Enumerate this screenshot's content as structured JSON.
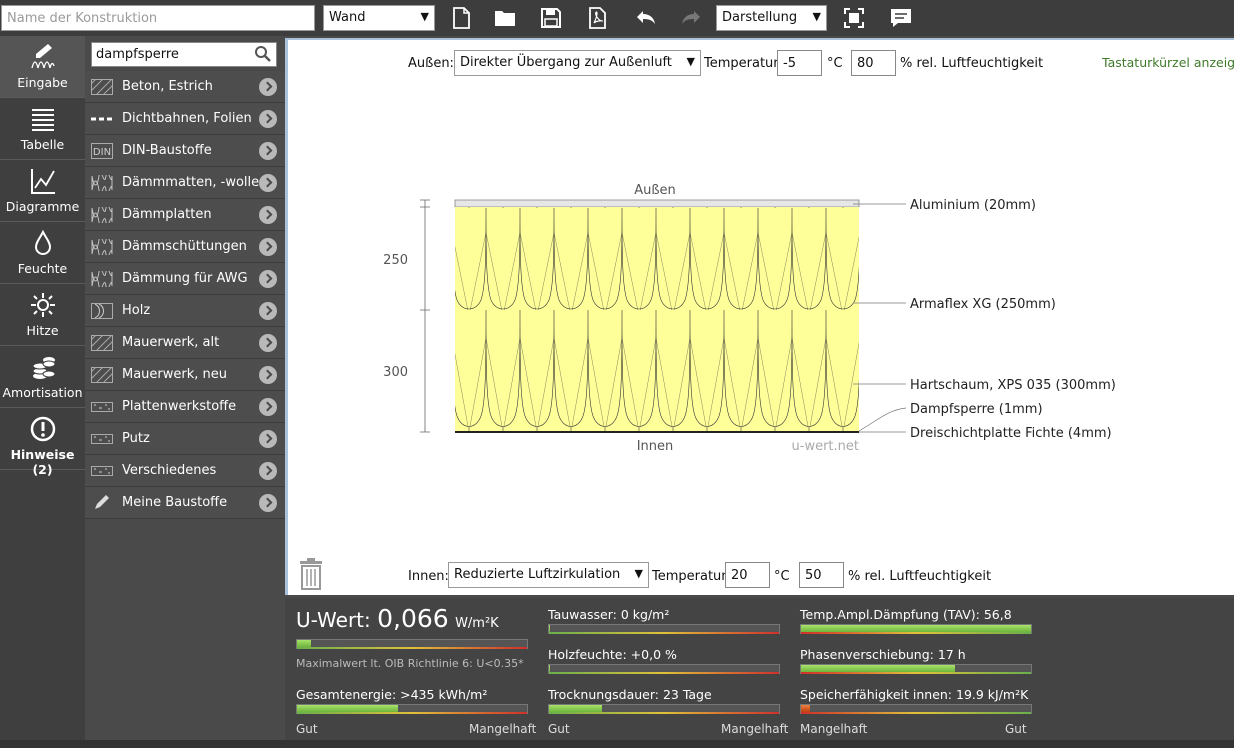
{
  "topbar": {
    "name_placeholder": "Name der Konstruktion",
    "type_select": "Wand",
    "view_select": "Darstellung",
    "icons": [
      "new-document-icon",
      "open-folder-icon",
      "save-icon",
      "pdf-icon",
      "undo-icon",
      "redo-icon",
      "fullscreen-icon",
      "comment-icon"
    ]
  },
  "nav": [
    {
      "label": "Eingabe",
      "icon": "edit-layers-icon"
    },
    {
      "label": "Tabelle",
      "icon": "table-list-icon"
    },
    {
      "label": "Diagramme",
      "icon": "chart-icon"
    },
    {
      "label": "Feuchte",
      "icon": "drop-icon"
    },
    {
      "label": "Hitze",
      "icon": "sun-icon"
    },
    {
      "label": "Amortisation",
      "icon": "coins-icon"
    },
    {
      "label": "Hinweise (2)",
      "icon": "warning-icon"
    }
  ],
  "search": {
    "value": "dampfsperre"
  },
  "materials": [
    {
      "label": "Beton, Estrich",
      "icon": "hatch-icon"
    },
    {
      "label": "Dichtbahnen, Folien",
      "icon": "dash-line-icon"
    },
    {
      "label": "DIN-Baustoffe",
      "icon": "din-icon"
    },
    {
      "label": "Dämmmatten, -wolle",
      "icon": "insulation-icon"
    },
    {
      "label": "Dämmplatten",
      "icon": "insulation-icon"
    },
    {
      "label": "Dämmschüttungen",
      "icon": "insulation-icon"
    },
    {
      "label": "Dämmung für AWG",
      "icon": "insulation-icon"
    },
    {
      "label": "Holz",
      "icon": "wood-icon"
    },
    {
      "label": "Mauerwerk, alt",
      "icon": "hatch-icon"
    },
    {
      "label": "Mauerwerk, neu",
      "icon": "hatch-icon"
    },
    {
      "label": "Plattenwerkstoffe",
      "icon": "board-icon"
    },
    {
      "label": "Putz",
      "icon": "board-icon"
    },
    {
      "label": "Verschiedenes",
      "icon": "board-icon"
    },
    {
      "label": "Meine Baustoffe",
      "icon": "pencil-icon"
    }
  ],
  "outside": {
    "label": "Außen:",
    "condition": "Direkter Übergang zur Außenluft",
    "temp_label": "Temperatur:",
    "temp": "-5",
    "temp_unit": "°C",
    "humidity": "80",
    "humidity_label": "% rel. Luftfeuchtigkeit"
  },
  "inside": {
    "label": "Innen:",
    "condition": "Reduzierte Luftzirkulation",
    "temp_label": "Temperatur:",
    "temp": "20",
    "temp_unit": "°C",
    "humidity": "50",
    "humidity_label": "% rel. Luftfeuchtigkeit"
  },
  "shortcut_link": "Tastaturkürzel anzeigen",
  "diagram": {
    "top_label": "Außen",
    "bottom_label": "Innen",
    "watermark": "u-wert.net",
    "dimensions": [
      "250",
      "300"
    ],
    "layers": [
      "Aluminium (20mm)",
      "Armaflex XG (250mm)",
      "Hartschaum, XPS 035 (300mm)",
      "Dampfsperre (1mm)",
      "Dreischichtplatte Fichte (4mm)"
    ]
  },
  "results": {
    "uwert_label": "U-Wert:",
    "uwert_value": "0,066",
    "uwert_unit": "W/m²K",
    "uwert_level": 0.06,
    "max_note": "Maximalwert lt. OIB Richtlinie 6: U<0.35*",
    "gesamtenergie": {
      "label": "Gesamtenergie: >435 kWh/m²",
      "level": 0.44
    },
    "tauwasser": {
      "label": "Tauwasser: 0 kg/m²",
      "level": 0.0
    },
    "holzfeuchte": {
      "label": "Holzfeuchte: +0,0 %",
      "level": 0.0
    },
    "trocknung": {
      "label": "Trocknungsdauer: 23 Tage",
      "level": 0.23
    },
    "tav": {
      "label": "Temp.Ampl.Dämpfung (TAV): 56,8",
      "level": 1.0
    },
    "phase": {
      "label": "Phasenverschiebung: 17 h",
      "level": 0.67
    },
    "speicher": {
      "label": "Speicherfähigkeit innen: 19.9 kJ/m²K",
      "level": 0.04
    },
    "scale_good": "Gut",
    "scale_bad": "Mangelhaft"
  }
}
